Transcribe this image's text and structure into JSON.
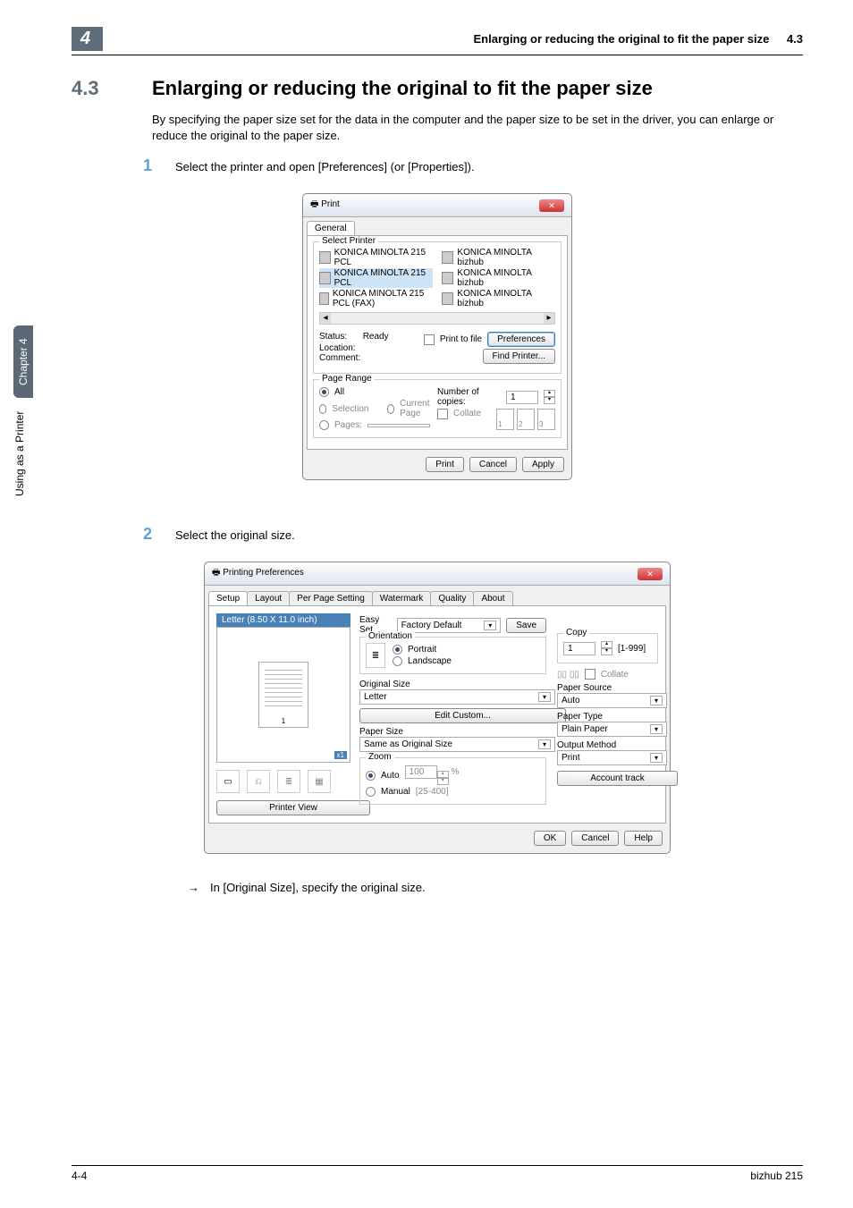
{
  "sidebar": {
    "tab": "Chapter 4",
    "label": "Using as a Printer"
  },
  "header": {
    "chapter_num": "4",
    "title": "Enlarging or reducing the original to fit the paper size",
    "sec": "4.3"
  },
  "section": {
    "num": "4.3",
    "title": "Enlarging or reducing the original to fit the paper size",
    "intro": "By specifying the paper size set for the data in the computer and the paper size to be set in the driver, you can enlarge or reduce the original to the paper size."
  },
  "steps": {
    "1": {
      "num": "1",
      "text": "Select the printer and open [Preferences] (or [Properties])."
    },
    "2": {
      "num": "2",
      "text": "Select the original size."
    },
    "sub": "In [Original Size], specify the original size."
  },
  "print_dialog": {
    "title": "Print",
    "tab_general": "General",
    "select_printer": "Select Printer",
    "printers": {
      "0": "KONICA MINOLTA 215 PCL",
      "1": "KONICA MINOLTA 215 PCL",
      "2": "KONICA MINOLTA 215 PCL (FAX)",
      "3": "KONICA MINOLTA bizhub",
      "4": "KONICA MINOLTA bizhub",
      "5": "KONICA MINOLTA bizhub"
    },
    "status_lbl": "Status:",
    "status_val": "Ready",
    "location_lbl": "Location:",
    "comment_lbl": "Comment:",
    "print_to_file": "Print to file",
    "preferences": "Preferences",
    "find_printer": "Find Printer...",
    "page_range": "Page Range",
    "all": "All",
    "selection": "Selection",
    "current_page": "Current Page",
    "pages": "Pages:",
    "copies_lbl": "Number of copies:",
    "copies_val": "1",
    "collate": "Collate",
    "collate_pages": {
      "1": "1",
      "2": "2",
      "3": "3"
    },
    "btn_print": "Print",
    "btn_cancel": "Cancel",
    "btn_apply": "Apply"
  },
  "prefs_dialog": {
    "title": "Printing Preferences",
    "tabs": {
      "setup": "Setup",
      "layout": "Layout",
      "per_page": "Per Page Setting",
      "watermark": "Watermark",
      "quality": "Quality",
      "about": "About"
    },
    "preview_label": "Letter (8.50 X 11.0 inch)",
    "page_num": "1",
    "x1": "x1",
    "printer_view": "Printer View",
    "easy_set": "Easy Set",
    "factory_default": "Factory Default",
    "save": "Save",
    "orientation": "Orientation",
    "portrait": "Portrait",
    "landscape": "Landscape",
    "original_size": "Original Size",
    "original_val": "Letter",
    "edit_custom": "Edit Custom...",
    "paper_size": "Paper Size",
    "paper_size_val": "Same as Original Size",
    "zoom": "Zoom",
    "auto": "Auto",
    "manual": "Manual",
    "zoom_val": "100",
    "pct": "%",
    "range": "[25-400]",
    "copy": "Copy",
    "copy_val": "1",
    "copy_range": "[1-999]",
    "collate": "Collate",
    "paper_source": "Paper Source",
    "paper_source_val": "Auto",
    "paper_type": "Paper Type",
    "paper_type_val": "Plain Paper",
    "output_method": "Output Method",
    "output_val": "Print",
    "account_track": "Account track",
    "ok": "OK",
    "cancel": "Cancel",
    "help": "Help"
  },
  "footer": {
    "page": "4-4",
    "model": "bizhub 215"
  }
}
